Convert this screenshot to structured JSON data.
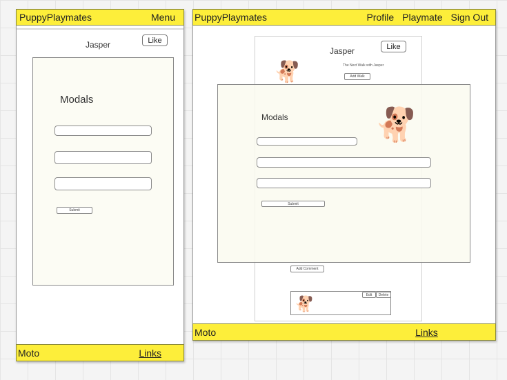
{
  "mobile": {
    "brand": "PuppyPlaymates",
    "menu_label": "Menu",
    "dog_name": "Jasper",
    "like_label": "Like",
    "modal_title": "Modals",
    "submit_label": "Submit",
    "footer_left": "Moto",
    "footer_right": "Links"
  },
  "desktop": {
    "brand": "PuppyPlaymates",
    "nav": [
      "Profile",
      "Playmate",
      "Sign Out"
    ],
    "dog_name": "Jasper",
    "like_label": "Like",
    "next_walk": "The Next Walk with Jasper",
    "add_walk_label": "Add Walk",
    "modal_title": "Modals",
    "submit_label": "Submit",
    "add_comment_label": "Add Comment",
    "edit_label": "Edit",
    "delete_label": "Delete",
    "footer_left": "Moto",
    "footer_right": "Links"
  },
  "icons": {
    "dog": "🐕"
  }
}
